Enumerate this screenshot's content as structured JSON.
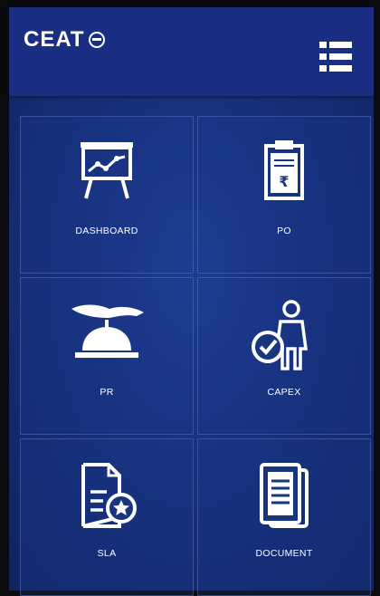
{
  "app": {
    "logo_text": "CEAT"
  },
  "header": {
    "menu_icon": "list-menu-icon"
  },
  "tiles": [
    {
      "label": "DASHBOARD",
      "icon": "presentation-board-icon"
    },
    {
      "label": "PO",
      "icon": "clipboard-rupee-icon"
    },
    {
      "label": "PR",
      "icon": "service-bell-hand-icon"
    },
    {
      "label": "CAPEX",
      "icon": "person-checkmark-icon"
    },
    {
      "label": "SLA",
      "icon": "document-badge-icon"
    },
    {
      "label": "DOCUMENT",
      "icon": "documents-stack-icon"
    }
  ],
  "colors": {
    "background": "#16307a",
    "header": "#1a2f84",
    "foreground": "#ffffff"
  }
}
